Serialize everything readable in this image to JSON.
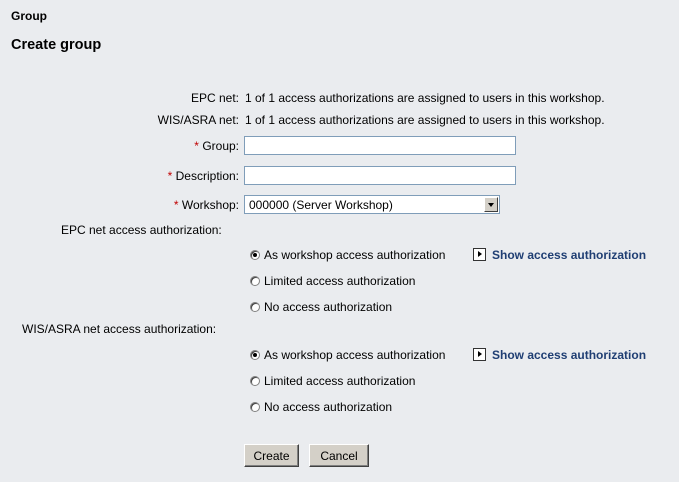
{
  "breadcrumb": "Group",
  "title": "Create group",
  "info": {
    "epc_label": "EPC net:",
    "epc_text": "1 of 1 access authorizations are assigned to users in this workshop.",
    "wis_label": "WIS/ASRA net:",
    "wis_text": "1 of 1 access authorizations are assigned to users in this workshop."
  },
  "form": {
    "required_marker": "*",
    "group_label": "Group:",
    "group_value": "",
    "description_label": "Description:",
    "description_value": "",
    "workshop_label": "Workshop:",
    "workshop_value": "000000 (Server Workshop)"
  },
  "epc_access": {
    "label": "EPC net access authorization:",
    "options": [
      {
        "label": "As workshop access authorization",
        "checked": true
      },
      {
        "label": "Limited access authorization",
        "checked": false
      },
      {
        "label": "No access authorization",
        "checked": false
      }
    ],
    "show_link": "Show access authorization"
  },
  "wis_access": {
    "label": "WIS/ASRA net access authorization:",
    "options": [
      {
        "label": "As workshop access authorization",
        "checked": true
      },
      {
        "label": "Limited access authorization",
        "checked": false
      },
      {
        "label": "No access authorization",
        "checked": false
      }
    ],
    "show_link": "Show access authorization"
  },
  "buttons": {
    "create": "Create",
    "cancel": "Cancel"
  },
  "colors": {
    "background": "#eaecef",
    "link": "#1f3e73",
    "required": "#c00000"
  }
}
